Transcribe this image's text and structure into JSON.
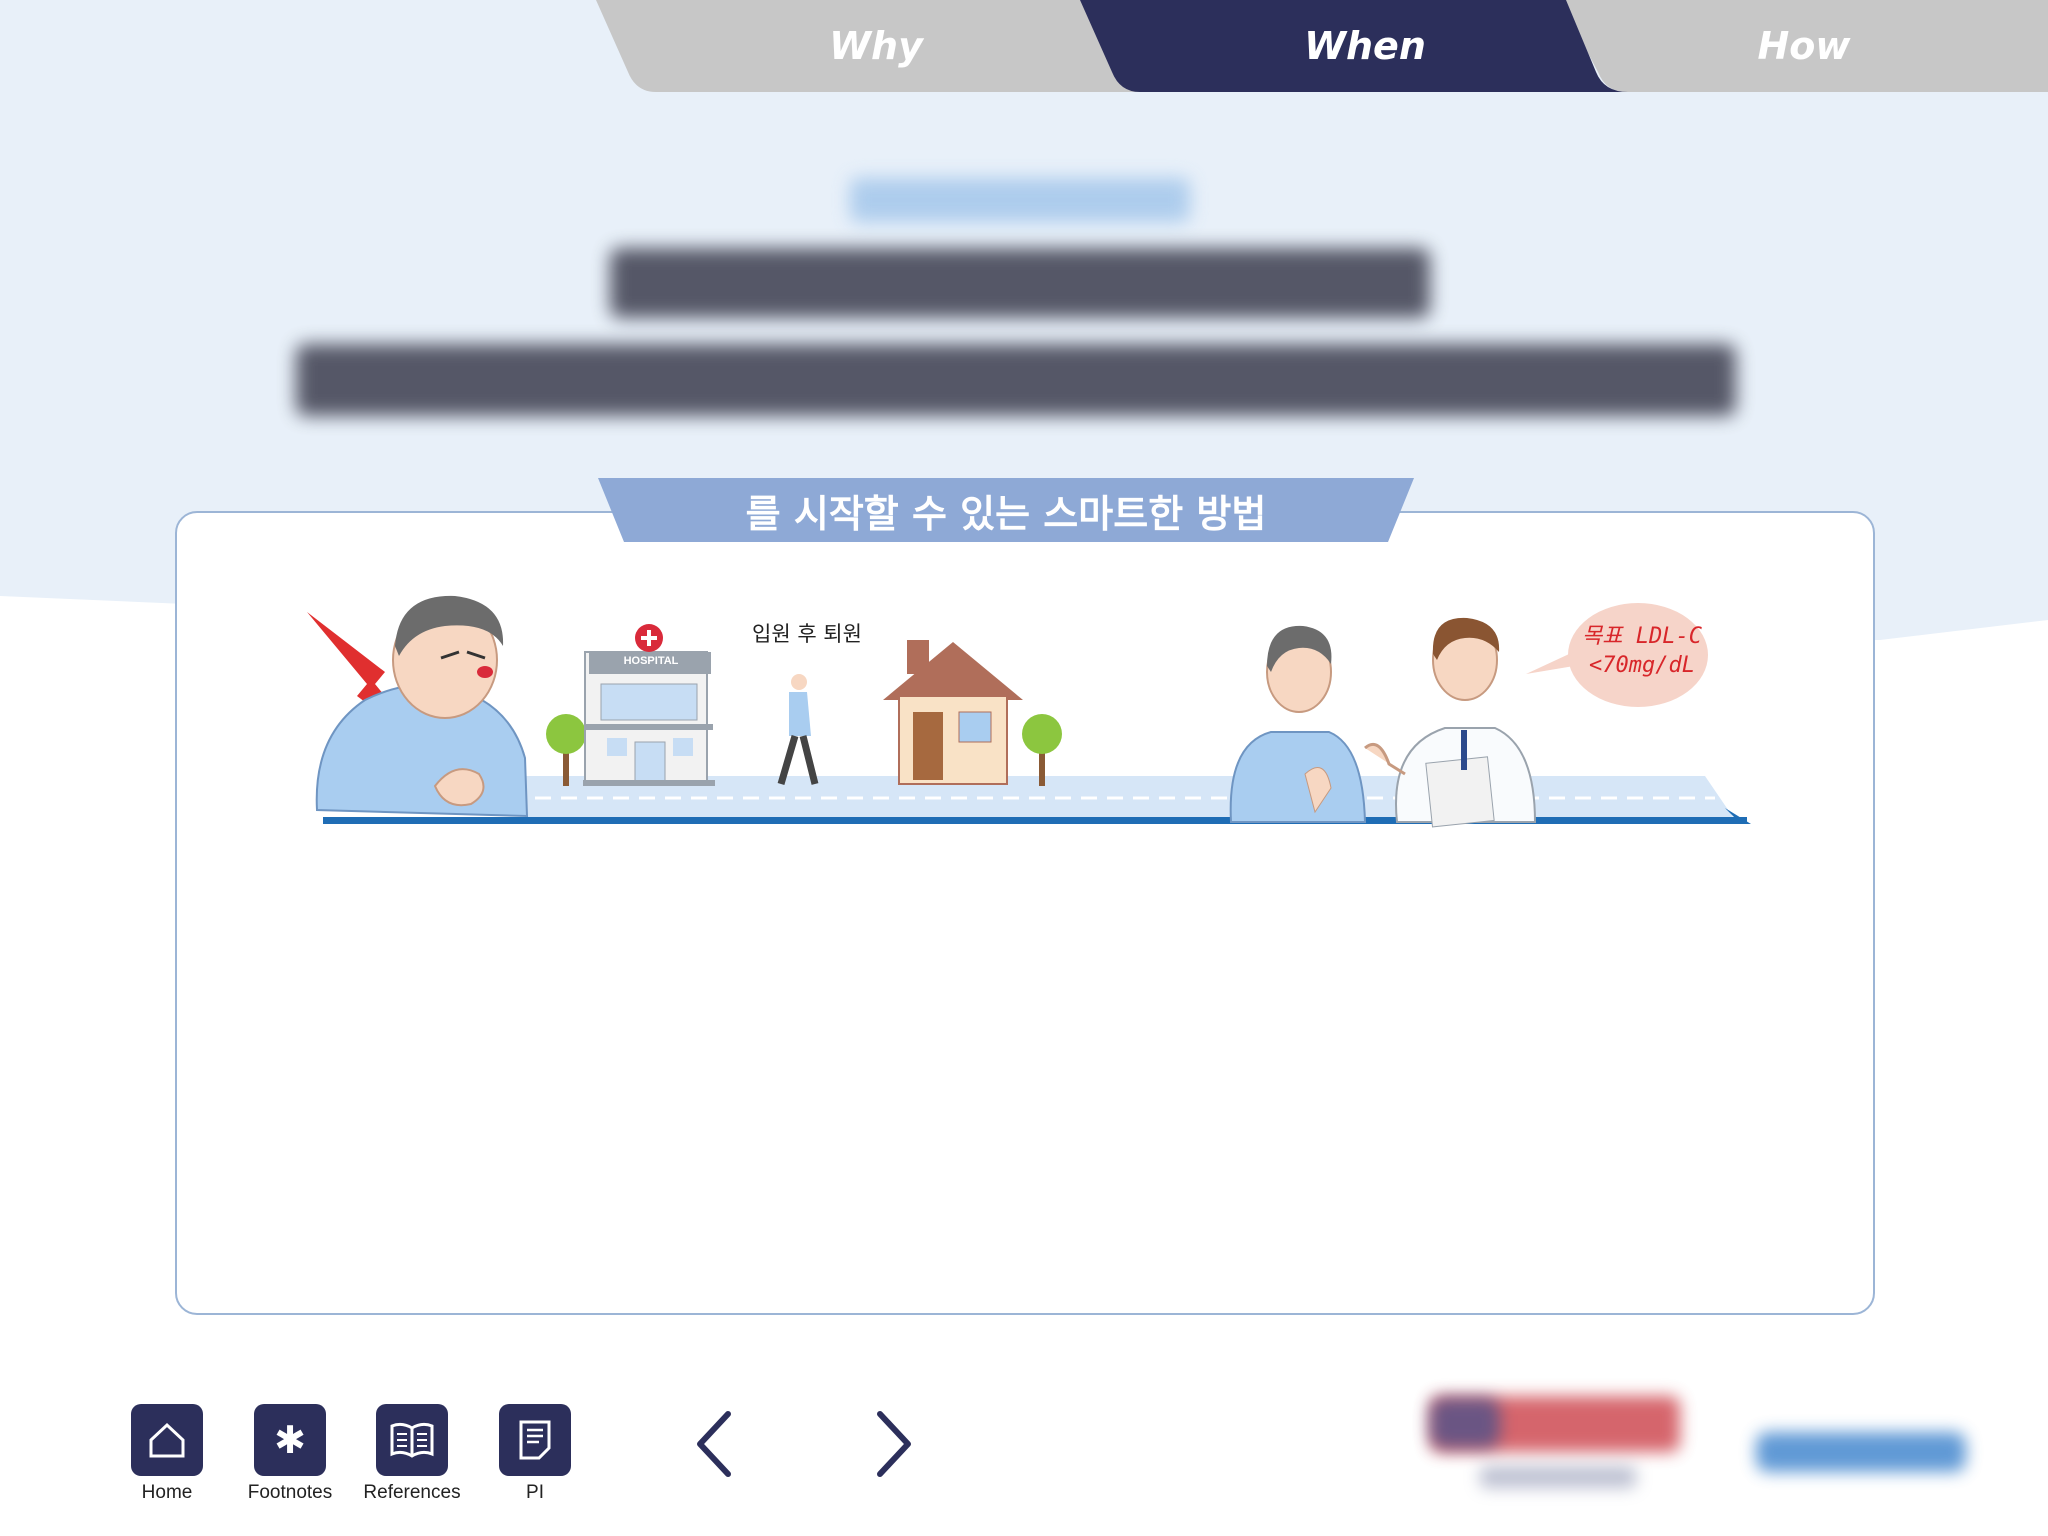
{
  "tabs": [
    {
      "label": "Why",
      "active": false
    },
    {
      "label": "When",
      "active": true
    },
    {
      "label": "How",
      "active": false
    }
  ],
  "card": {
    "banner": "를 시작할 수 있는 스마트한 방법",
    "walk_caption": "입원 후 퇴원",
    "hospital_sign": "HOSPITAL",
    "speech_bubble": {
      "line1": "목표 LDL-C",
      "line2": "<70mg/dL"
    }
  },
  "nav": {
    "home": "Home",
    "footnotes": "Footnotes",
    "references": "References",
    "pi": "PI"
  },
  "colors": {
    "tab_active": "#2c2f5b",
    "tab_inactive": "#c7c7c7",
    "banner": "#8ea9d6",
    "background_top": "#e8f0f9",
    "card_border": "#9cb5d6",
    "alert_red": "#d8262a"
  }
}
